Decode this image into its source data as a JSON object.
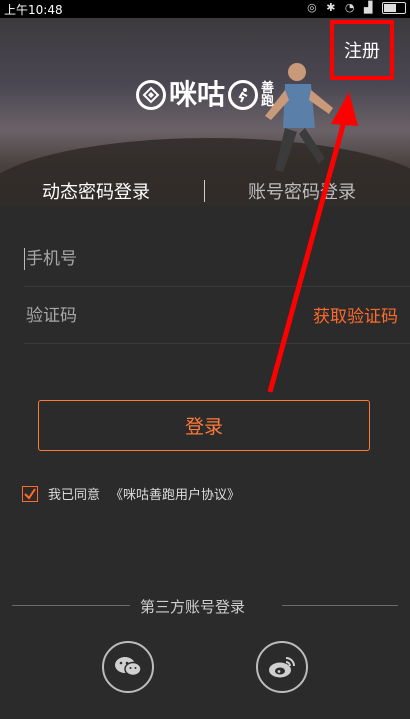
{
  "statusbar": {
    "time": "上午10:48"
  },
  "header": {
    "register_label": "注册",
    "logo_text_main": "咪咕",
    "logo_text_side": "善跑"
  },
  "tabs": {
    "dynamic_login": "动态密码登录",
    "account_login": "账号密码登录"
  },
  "form": {
    "phone_placeholder": "手机号",
    "code_placeholder": "验证码",
    "get_code_label": "获取验证码",
    "login_label": "登录"
  },
  "agreement": {
    "prefix": "我已同意",
    "link": "《咪咕善跑用户协议》",
    "checked": true
  },
  "third_party": {
    "label": "第三方账号登录",
    "providers": [
      "wechat-icon",
      "weibo-icon"
    ]
  },
  "colors": {
    "accent": "#ff6b2b",
    "annotation": "#ff0000",
    "background": "#2b2b2b"
  }
}
